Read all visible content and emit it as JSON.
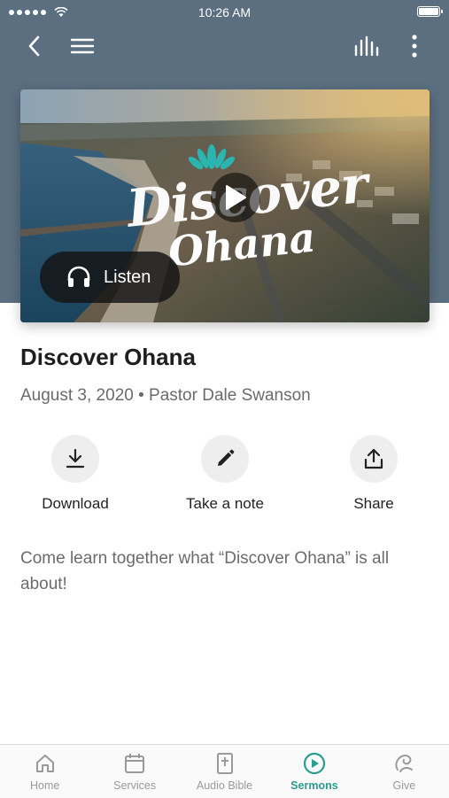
{
  "status_bar": {
    "time": "10:26 AM",
    "battery_level": 1.0
  },
  "nav": {
    "back_icon": "chevron-left-icon",
    "menu_icon": "hamburger-menu-icon",
    "audio_icon": "equalizer-icon",
    "more_icon": "more-vertical-icon"
  },
  "hero": {
    "logo_line1": "Discover",
    "logo_line2": "Ohana",
    "play_icon": "play-icon",
    "listen_label": "Listen",
    "listen_icon": "headphones-icon"
  },
  "sermon": {
    "title": "Discover Ohana",
    "meta": "August 3, 2020 • Pastor Dale Swanson",
    "description": "Come learn together what “Discover Ohana” is all about!"
  },
  "actions": [
    {
      "label": "Download",
      "icon": "download-icon"
    },
    {
      "label": "Take a note",
      "icon": "pencil-icon"
    },
    {
      "label": "Share",
      "icon": "share-icon"
    }
  ],
  "tabs": [
    {
      "label": "Home",
      "icon": "home-icon",
      "active": false
    },
    {
      "label": "Services",
      "icon": "calendar-icon",
      "active": false
    },
    {
      "label": "Audio Bible",
      "icon": "bible-icon",
      "active": false
    },
    {
      "label": "Sermons",
      "icon": "play-circle-icon",
      "active": true
    },
    {
      "label": "Give",
      "icon": "give-icon",
      "active": false
    }
  ],
  "colors": {
    "header": "#5b6f80",
    "accent": "#2a9d8f",
    "tab_inactive": "#9a9a9a",
    "text_muted": "#6b6b6b"
  }
}
